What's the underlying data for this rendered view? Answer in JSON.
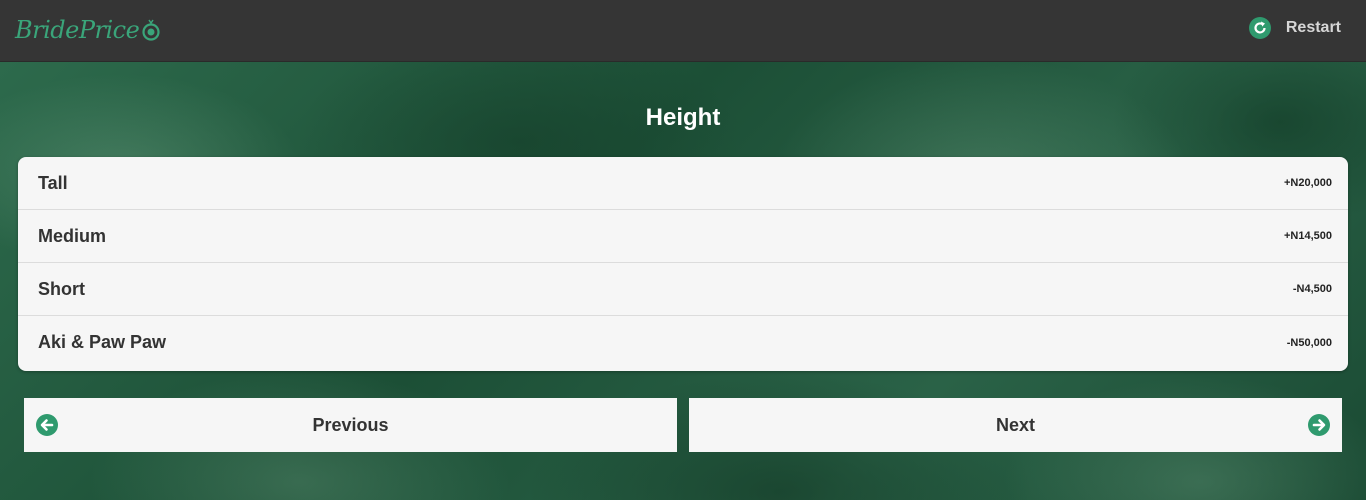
{
  "header": {
    "logo_text": "BridePrice",
    "restart_label": "Restart",
    "restart_icon": "refresh-icon"
  },
  "question": {
    "title": "Height",
    "options": [
      {
        "label": "Tall",
        "price": "+N20,000"
      },
      {
        "label": "Medium",
        "price": "+N14,500"
      },
      {
        "label": "Short",
        "price": "-N4,500"
      },
      {
        "label": "Aki & Paw Paw",
        "price": "-N50,000"
      }
    ]
  },
  "navigation": {
    "previous_label": "Previous",
    "previous_icon": "arrow-left-circle-icon",
    "next_label": "Next",
    "next_icon": "arrow-right-circle-icon"
  },
  "colors": {
    "accent": "#2f9a6e",
    "topbar": "#353535",
    "background": "#1f5a3e"
  }
}
